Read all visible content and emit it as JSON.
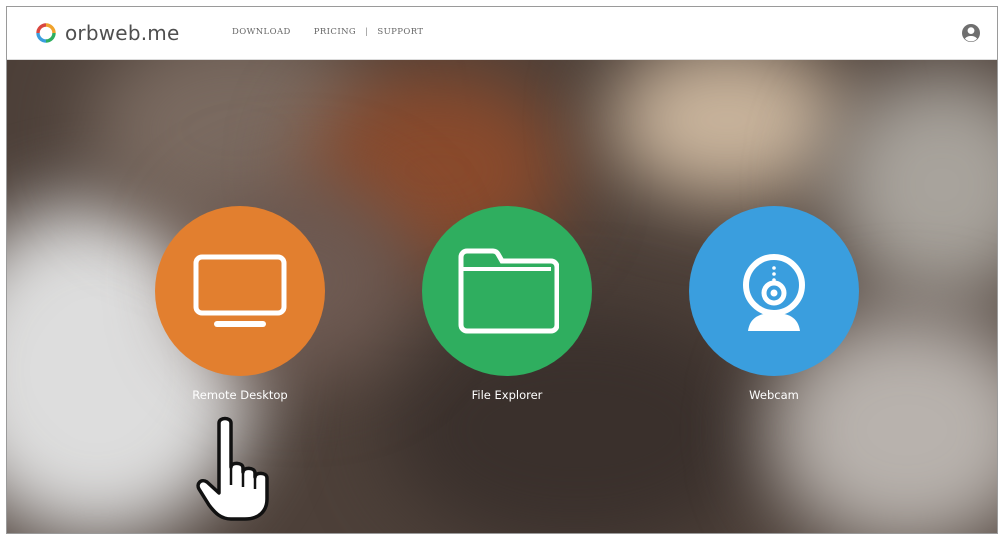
{
  "header": {
    "logo_text": "orbweb.me",
    "nav": {
      "download": "DOWNLOAD",
      "pricing": "PRICING",
      "separator": "|",
      "support": "SUPPORT"
    }
  },
  "apps": [
    {
      "label": "Remote Desktop",
      "icon": "monitor-icon",
      "color": "#e27f2f"
    },
    {
      "label": "File Explorer",
      "icon": "folder-icon",
      "color": "#2fae5f"
    },
    {
      "label": "Webcam",
      "icon": "webcam-icon",
      "color": "#3a9ede"
    }
  ],
  "icons": {
    "user": "user-account-icon",
    "pointer": "hand-pointer-icon"
  }
}
